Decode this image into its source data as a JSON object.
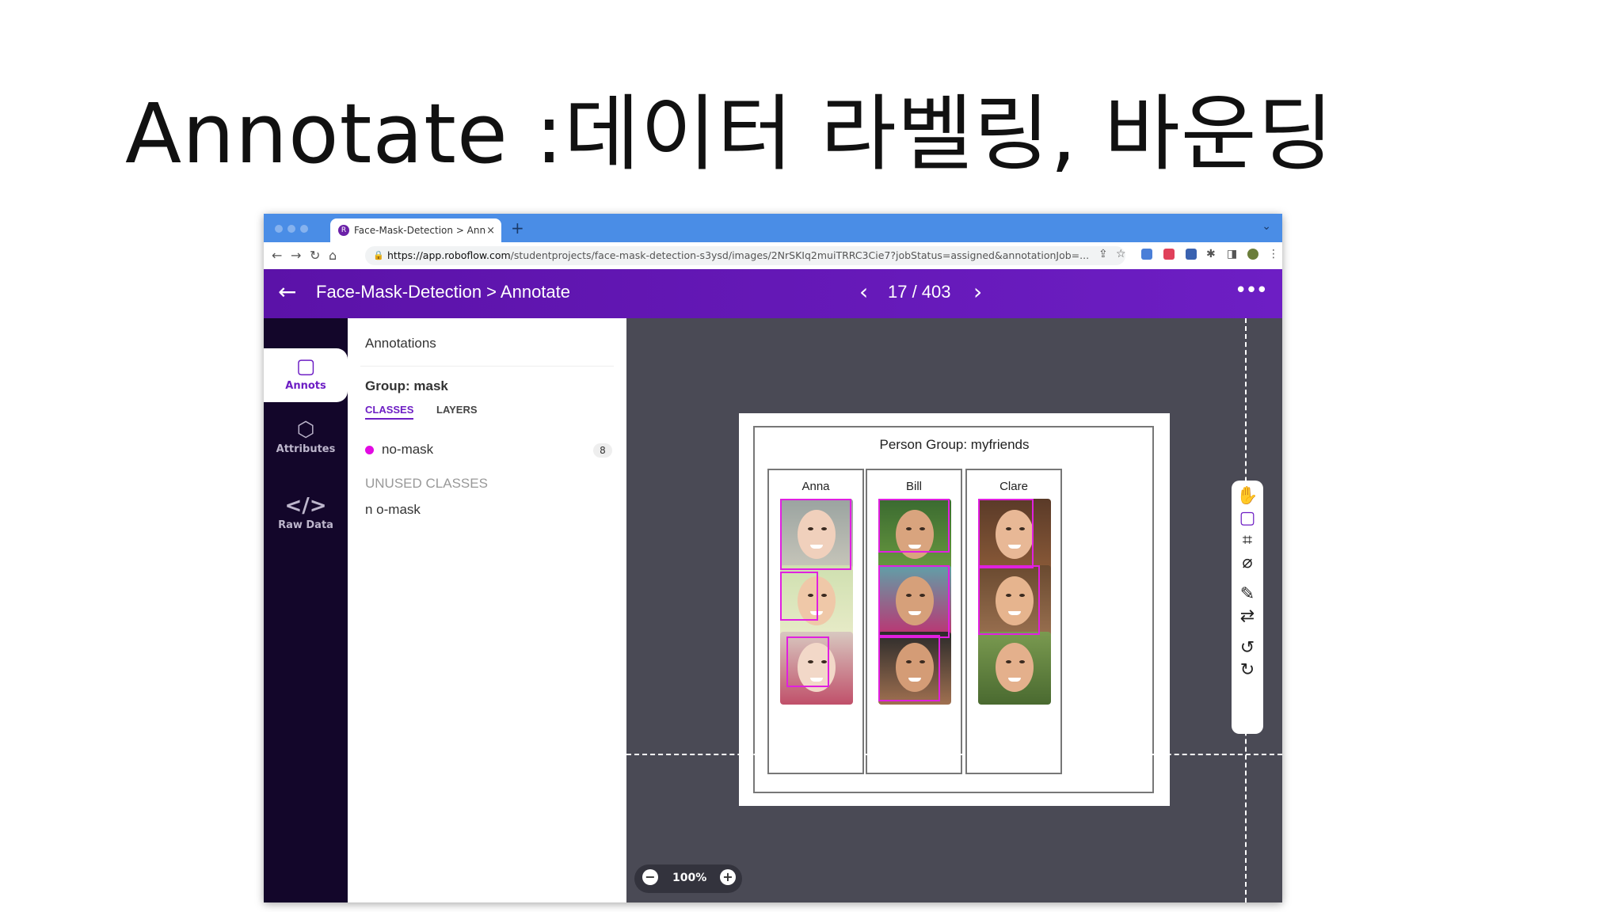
{
  "slide": {
    "title": "Annotate :데이터 라벨링, 바운딩"
  },
  "browser": {
    "tab_title": "Face-Mask-Detection > Annot",
    "tab_close": "×",
    "new_tab": "+",
    "url_host": "https://app.roboflow.com",
    "url_path": "/studentprojects/face-mask-detection-s3ysd/images/2NrSKIq2muiTRRC3Cie7?jobStatus=assigned&annotationJob=..."
  },
  "header": {
    "breadcrumb": "Face-Mask-Detection > Annotate",
    "counter": "17 / 403"
  },
  "leftnav": {
    "items": [
      {
        "label": "Annots",
        "icon": "sticky-note-icon"
      },
      {
        "label": "Attributes",
        "icon": "tag-icon"
      },
      {
        "label": "Raw Data",
        "icon": "code-icon"
      }
    ]
  },
  "panel": {
    "heading": "Annotations",
    "group": "Group: mask",
    "tab_classes": "CLASSES",
    "tab_layers": "LAYERS",
    "classes": [
      {
        "name": "no-mask",
        "count": "8",
        "color": "#e20ae2"
      }
    ],
    "unused_heading": "UNUSED CLASSES",
    "unused": [
      "n o-mask"
    ]
  },
  "image": {
    "title": "Person Group: myfriends",
    "columns": [
      {
        "name": "Anna"
      },
      {
        "name": "Bill"
      },
      {
        "name": "Clare"
      }
    ],
    "bbox_color": "#e020e0"
  },
  "zoom": {
    "value": "100%"
  },
  "colors": {
    "brand": "#6d1ec4",
    "nav_bg": "#13062a",
    "canvas_bg": "#4a4a55"
  }
}
